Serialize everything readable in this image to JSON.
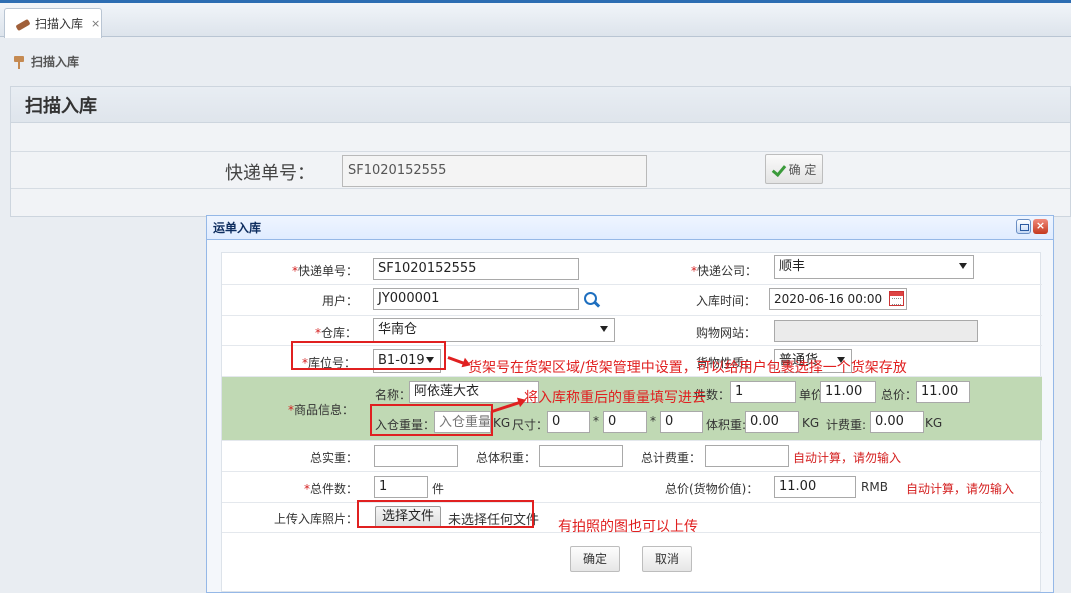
{
  "tab": {
    "label": "扫描入库",
    "close": "×"
  },
  "breadcrumb": {
    "label": "扫描入库"
  },
  "page": {
    "title": "扫描入库",
    "tracking_label": "快递单号：",
    "tracking_value": "SF1020152555",
    "confirm_label": "确 定"
  },
  "dialog": {
    "title": "运单入库",
    "close": "×",
    "req_mark": "*",
    "express_no": {
      "label": "快递单号：",
      "value": "SF1020152555"
    },
    "express_company": {
      "label": "快递公司：",
      "value": "顺丰"
    },
    "user": {
      "label": "用户：",
      "value": "JY000001"
    },
    "inbound_time": {
      "label": "入库时间：",
      "value": "2020-06-16 00:00"
    },
    "warehouse": {
      "label": "仓库：",
      "value": "华南仓"
    },
    "shop_site": {
      "label": "购物网站：",
      "value": ""
    },
    "shelf": {
      "label": "库位号：",
      "value": "B1-019"
    },
    "goods_nature": {
      "label": "货物性质：",
      "value": "普通货"
    },
    "goods": {
      "label": "商品信息：",
      "name_label": "名称：",
      "name_value": "阿依莲大衣",
      "count_label": "件数：",
      "count_value": "1",
      "price_label": "单价：",
      "price_value": "11.00",
      "total_label": "总价：",
      "total_value": "11.00",
      "weight_label": "入仓重量：",
      "weight_placeholder": "入仓重量",
      "kg": "KG",
      "size_label": "尺寸：",
      "dim1": "0",
      "star": "*",
      "dim2": "0",
      "dim3": "0",
      "vol_weight_label": "体积重:",
      "vol_weight_value": "0.00",
      "charge_weight_label": "计费重:",
      "charge_weight_value": "0.00"
    },
    "total_weight": {
      "label": "总实重：",
      "value": ""
    },
    "total_vol_weight": {
      "label": "总体积重：",
      "value": ""
    },
    "total_charge_weight": {
      "label": "总计费重：",
      "value": ""
    },
    "auto_calc_1": "自动计算，请勿输入",
    "total_pieces": {
      "label": "总件数：",
      "value": "1",
      "unit": "件"
    },
    "total_value": {
      "label": "总价(货物价值)：",
      "value": "11.00",
      "unit": "RMB"
    },
    "auto_calc_2": "自动计算，请勿输入",
    "upload": {
      "label": "上传入库照片：",
      "button": "选择文件",
      "status": "未选择任何文件"
    },
    "ok_label": "确定",
    "cancel_label": "取消"
  },
  "annotations": {
    "shelf_note": "货架号在货架区域/货架管理中设置，可以给用户包裹选择一个货架存放",
    "weight_note": "将入库称重后的重量填写进去",
    "photo_note": "有拍照的图也可以上传"
  },
  "colors": {
    "accent_blue": "#2d6db2",
    "goods_row_bg": "#c0d9b4",
    "annotation_red": "#e02020",
    "required_red": "#d42020"
  }
}
